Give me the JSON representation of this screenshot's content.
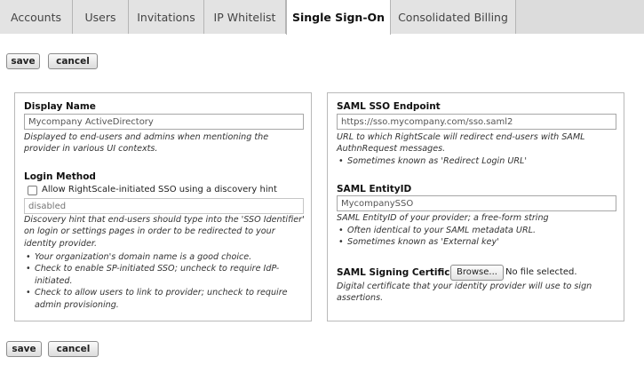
{
  "tabs": [
    {
      "label": "Accounts"
    },
    {
      "label": "Users"
    },
    {
      "label": "Invitations"
    },
    {
      "label": "IP Whitelist"
    },
    {
      "label": "Single Sign-On",
      "active": true
    },
    {
      "label": "Consolidated Billing"
    }
  ],
  "toolbar": {
    "save_label": "save",
    "cancel_label": "cancel"
  },
  "left": {
    "display_name": {
      "label": "Display Name",
      "value": "Mycompany ActiveDirectory",
      "help": "Displayed to end-users and admins when mentioning the provider in various UI contexts."
    },
    "login_method": {
      "label": "Login Method",
      "checkbox_label": "Allow RightScale-initiated SSO using a discovery hint",
      "checked": false,
      "hint_placeholder": "disabled",
      "help": "Discovery hint that end-users should type into the 'SSO Identifier' on login or settings pages in order to be redirected to your identity provider.",
      "bullets": [
        "Your organization's domain name is a good choice.",
        "Check to enable SP-initiated SSO; uncheck to require IdP-initiated.",
        "Check to allow users to link to provider; uncheck to require admin provisioning."
      ]
    }
  },
  "right": {
    "endpoint": {
      "label": "SAML SSO Endpoint",
      "value": "https://sso.mycompany.com/sso.saml2",
      "help": "URL to which RightScale will redirect end-users with SAML AuthnRequest messages.",
      "bullets": [
        "Sometimes known as 'Redirect Login URL'"
      ]
    },
    "entity_id": {
      "label": "SAML EntityID",
      "value": "MycompanySSO",
      "help": "SAML EntityID of your provider; a free-form string",
      "bullets": [
        "Often identical to your SAML metadata URL.",
        "Sometimes known as 'External key'"
      ]
    },
    "certificate": {
      "label": "SAML Signing Certificate",
      "browse_label": "Browse...",
      "file_status": "No file selected.",
      "help": "Digital certificate that your identity provider will use to sign assertions."
    }
  }
}
